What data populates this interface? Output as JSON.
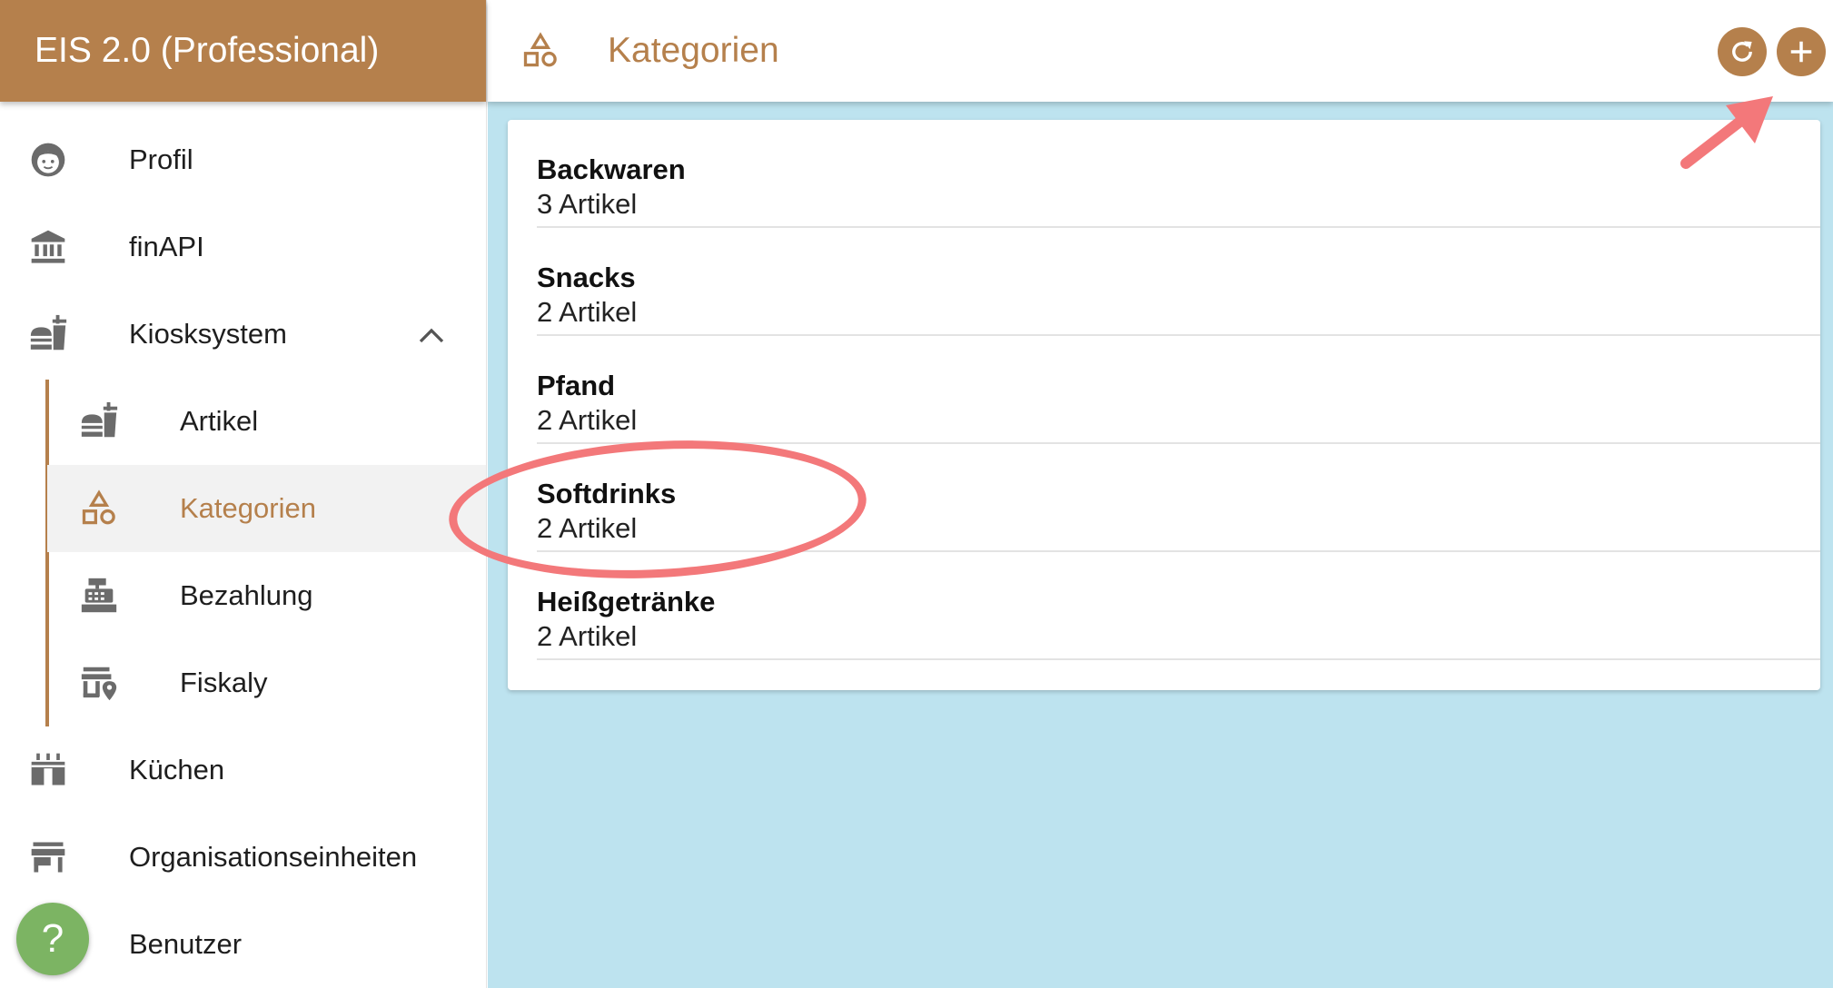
{
  "app": {
    "title": "EIS 2.0 (Professional)"
  },
  "sidebar": {
    "items": [
      {
        "label": "Profil",
        "icon": "face-icon"
      },
      {
        "label": "finAPI",
        "icon": "bank-icon"
      },
      {
        "label": "Kiosksystem",
        "icon": "kiosk-icon",
        "expanded": true
      },
      {
        "label": "Artikel",
        "icon": "kiosk-icon"
      },
      {
        "label": "Kategorien",
        "icon": "shapes-icon",
        "active": true
      },
      {
        "label": "Bezahlung",
        "icon": "cash-register-icon"
      },
      {
        "label": "Fiskaly",
        "icon": "store-location-icon"
      },
      {
        "label": "Küchen",
        "icon": "kitchen-icon"
      },
      {
        "label": "Organisationseinheiten",
        "icon": "store-icon"
      },
      {
        "label": "Benutzer",
        "icon": "user-icon"
      }
    ],
    "help_label": "?"
  },
  "header": {
    "title": "Kategorien",
    "refresh_icon": "refresh-icon",
    "add_icon": "plus-icon"
  },
  "categories": [
    {
      "name": "Backwaren",
      "count": "3 Artikel"
    },
    {
      "name": "Snacks",
      "count": "2 Artikel"
    },
    {
      "name": "Pfand",
      "count": "2 Artikel"
    },
    {
      "name": "Softdrinks",
      "count": "2 Artikel"
    },
    {
      "name": "Heißgetränke",
      "count": "2 Artikel"
    }
  ],
  "colors": {
    "brand": "#b5804c",
    "content_bg": "#bde3ef",
    "annotation": "#f3787a",
    "help": "#7cb463"
  }
}
